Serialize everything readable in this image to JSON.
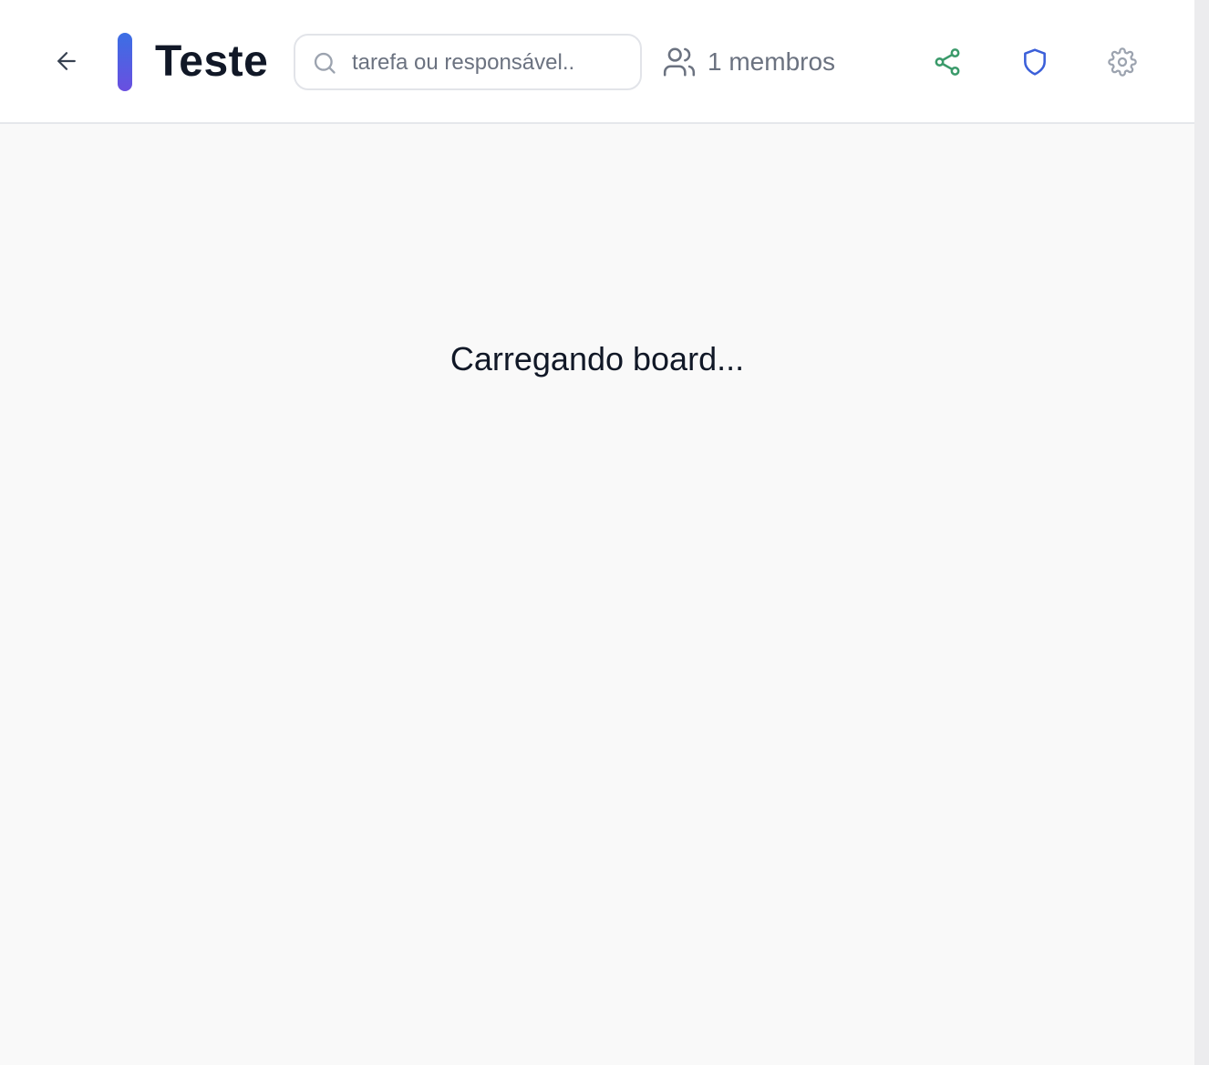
{
  "header": {
    "title": "Teste",
    "title_accent_colors": [
      "#3b6fe4",
      "#6a4fe0"
    ],
    "back_icon": "arrow-left-icon",
    "search": {
      "placeholder": "tarefa ou responsável..",
      "value": "",
      "icon": "search-icon"
    },
    "members": {
      "icon": "users-icon",
      "label": "1 membros"
    },
    "actions": [
      {
        "name": "share",
        "icon": "share-icon",
        "color": "#3a9a6a"
      },
      {
        "name": "permissions",
        "icon": "shield-icon",
        "color": "#3b5fd9"
      },
      {
        "name": "settings",
        "icon": "gear-icon",
        "color": "#9ca3af"
      }
    ]
  },
  "main": {
    "loading_text": "Carregando board..."
  }
}
